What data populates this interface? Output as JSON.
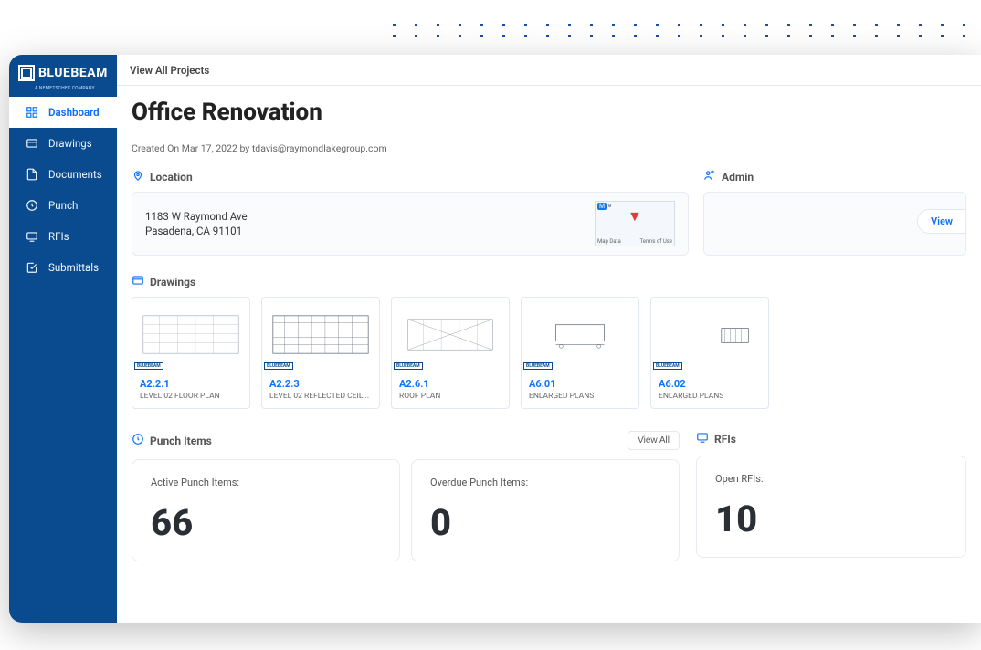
{
  "brand": {
    "name": "BLUEBEAM",
    "sub": "A NEMETSCHEK COMPANY"
  },
  "topbar": {
    "view_all_projects": "View All Projects"
  },
  "sidebar": {
    "items": [
      {
        "label": "Dashboard"
      },
      {
        "label": "Drawings"
      },
      {
        "label": "Documents"
      },
      {
        "label": "Punch"
      },
      {
        "label": "RFIs"
      },
      {
        "label": "Submittals"
      }
    ]
  },
  "page": {
    "title": "Office Renovation",
    "meta": "Created On Mar 17, 2022 by tdavis@raymondlakegroup.com"
  },
  "location": {
    "header": "Location",
    "address_line1": "1183 W Raymond Ave",
    "address_line2": "Pasadena, CA 91101",
    "map_label_left": "Map Data",
    "map_label_right": "Terms of Use",
    "map_top_badge": "M"
  },
  "admin": {
    "header": "Admin",
    "view_label": "View"
  },
  "drawings": {
    "header": "Drawings",
    "items": [
      {
        "code": "A2.2.1",
        "name": "LEVEL 02 FLOOR PLAN"
      },
      {
        "code": "A2.2.3",
        "name": "LEVEL 02 REFLECTED CEIL..."
      },
      {
        "code": "A2.6.1",
        "name": "ROOF PLAN"
      },
      {
        "code": "A6.01",
        "name": "ENLARGED PLANS"
      },
      {
        "code": "A6.02",
        "name": "ENLARGED PLANS"
      }
    ]
  },
  "punch": {
    "header": "Punch Items",
    "view_all": "View All",
    "cards": [
      {
        "label": "Active Punch Items:",
        "value": "66"
      },
      {
        "label": "Overdue Punch Items:",
        "value": "0"
      }
    ]
  },
  "rfis": {
    "header": "RFIs",
    "cards": [
      {
        "label": "Open RFIs:",
        "value": "10"
      }
    ]
  }
}
